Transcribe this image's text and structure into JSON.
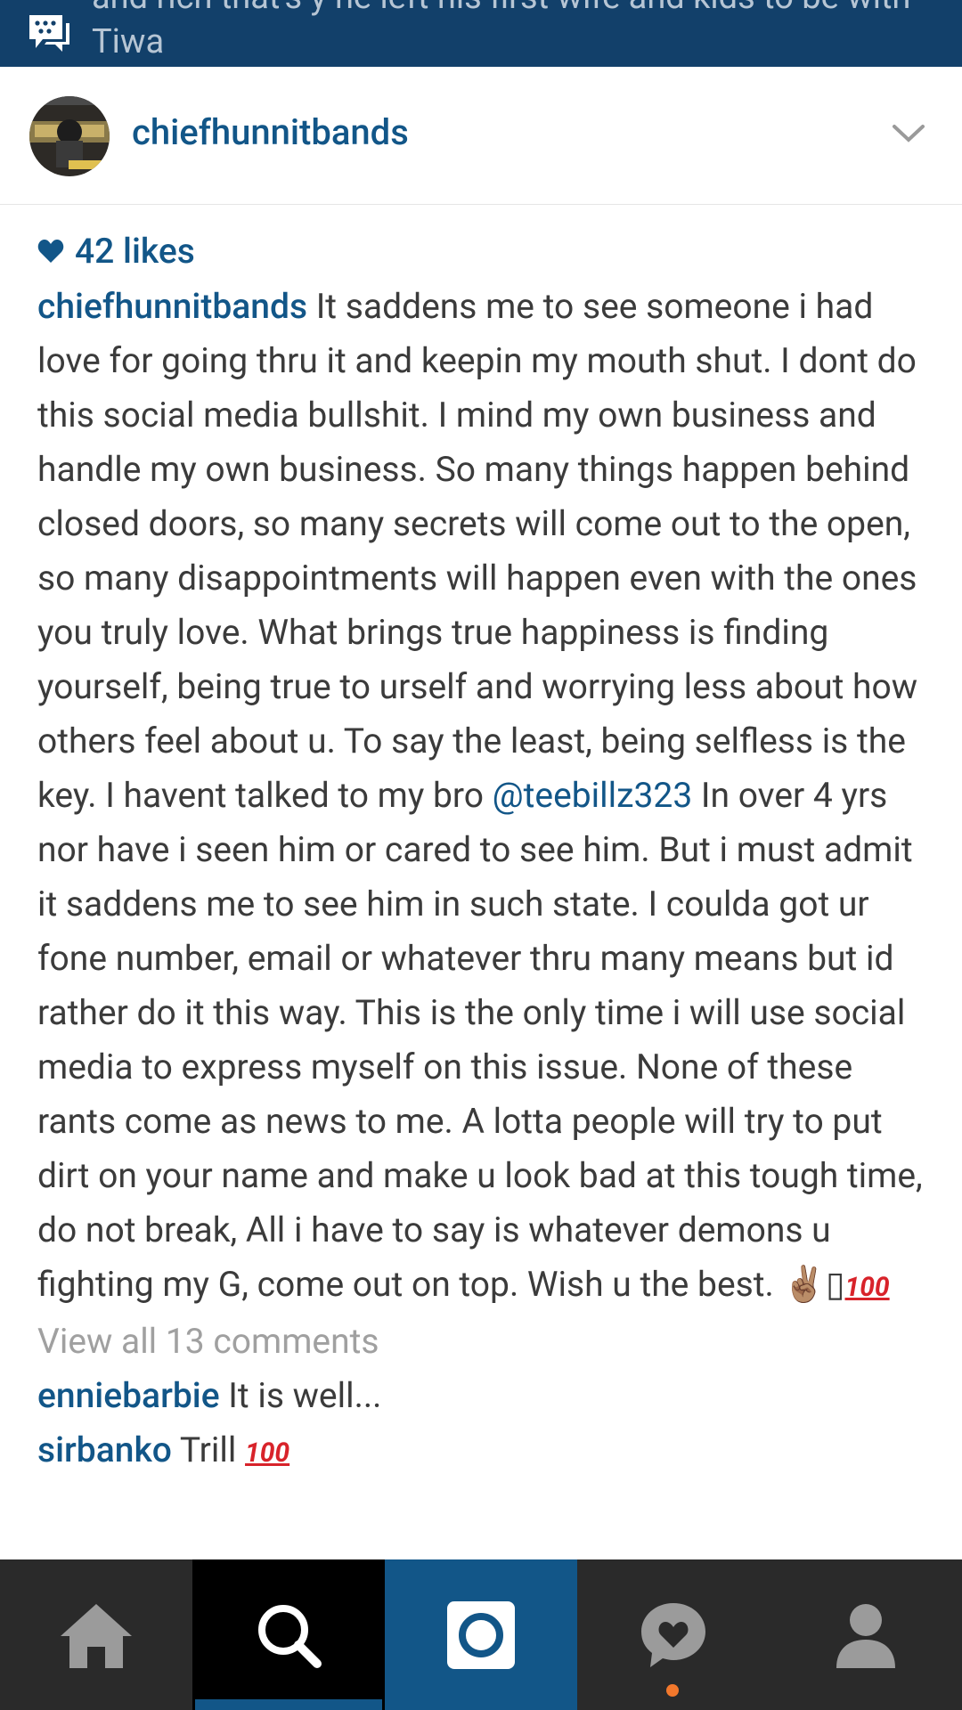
{
  "notification": {
    "text": "and rich that's y he left his first wife and kids to be with Tiwa",
    "icon": "bbm-chat-icon"
  },
  "header": {
    "username": "chiefhunnitbands",
    "avatar": "avatar-image",
    "menu_icon": "chevron-down-icon"
  },
  "post": {
    "likes": "42 likes",
    "caption_username": "chiefhunnitbands",
    "caption_part1": " It saddens me to see someone i had love for going thru it and keepin my mouth shut. I dont do this social media bullshit. I mind my own business and handle my own business. So many things happen behind closed doors, so many secrets will come out to the open, so many disappointments will happen even with the ones you truly love.  What brings true happiness is finding yourself, being true to urself and worrying less about how others feel about u. To say the least, being selfless is the key. I havent talked to my bro ",
    "mention": "@teebillz323",
    "caption_part2": "  In over 4 yrs nor have i seen him or cared to see him. But i must admit it saddens me to see him in such state. I coulda got ur fone number, email or whatever thru many means but id rather do it this way. This is the only time i will use social media to express myself on this issue. None of these rants come as news to me. A lotta people will try to put dirt on your name and make u look bad at this tough time, do not break, All i have to say is whatever demons u fighting my G, come out on top. Wish u the best. ",
    "caption_emoji_peace": "✌🏽",
    "caption_emoji_missing": "▯",
    "caption_emoji_100": "100",
    "view_all_comments": "View all 13 comments",
    "comments": [
      {
        "username": "enniebarbie",
        "text": " It is well..."
      },
      {
        "username": "sirbanko",
        "text": " Trill ",
        "emoji": "100"
      }
    ]
  },
  "nav": {
    "items": [
      "home-icon",
      "search-icon",
      "camera-icon",
      "activity-icon",
      "profile-icon"
    ],
    "active": "search",
    "accent": "#125688",
    "notification_dot_color": "#f2782c"
  }
}
